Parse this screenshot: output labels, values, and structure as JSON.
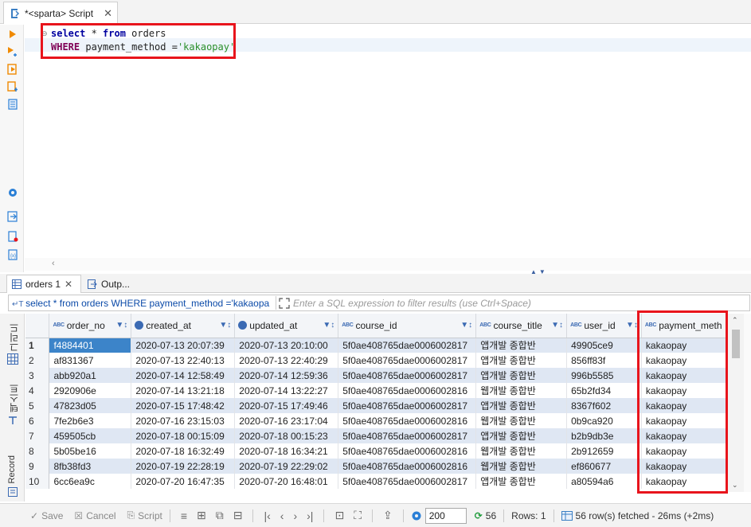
{
  "editor_tab": {
    "title": "*<sparta> Script",
    "close": "✕"
  },
  "editor": {
    "line1": {
      "k1": "select",
      "t1": " * ",
      "k2": "from",
      "t2": " orders"
    },
    "line2": {
      "k1": "WHERE",
      "t1": " payment_method =",
      "s1": "'kakaopay'"
    }
  },
  "result_tabs": [
    {
      "label": "orders 1",
      "close": "✕"
    },
    {
      "label": "Outp..."
    }
  ],
  "filter": {
    "query": "select * from orders WHERE payment_method ='kakaopa",
    "placeholder": "Enter a SQL expression to filter results (use Ctrl+Space)"
  },
  "side_tabs": [
    "그리드",
    "텍스트",
    "Record"
  ],
  "columns": [
    {
      "name": "order_no",
      "type_badge": "ABC"
    },
    {
      "name": "created_at",
      "type_badge": "clock"
    },
    {
      "name": "updated_at",
      "type_badge": "clock"
    },
    {
      "name": "course_id",
      "type_badge": "ABC"
    },
    {
      "name": "course_title",
      "type_badge": "ABC"
    },
    {
      "name": "user_id",
      "type_badge": "ABC"
    },
    {
      "name": "payment_meth",
      "type_badge": "ABC"
    }
  ],
  "rows": [
    [
      "1",
      "f4884401",
      "2020-07-13 20:07:39",
      "2020-07-13 20:10:00",
      "5f0ae408765dae0006002817",
      "앱개발 종합반",
      "49905ce9",
      "kakaopay"
    ],
    [
      "2",
      "af831367",
      "2020-07-13 22:40:13",
      "2020-07-13 22:40:29",
      "5f0ae408765dae0006002817",
      "앱개발 종합반",
      "856ff83f",
      "kakaopay"
    ],
    [
      "3",
      "abb920a1",
      "2020-07-14 12:58:49",
      "2020-07-14 12:59:36",
      "5f0ae408765dae0006002817",
      "앱개발 종합반",
      "996b5585",
      "kakaopay"
    ],
    [
      "4",
      "2920906e",
      "2020-07-14 13:21:18",
      "2020-07-14 13:22:27",
      "5f0ae408765dae0006002816",
      "웹개발 종합반",
      "65b2fd34",
      "kakaopay"
    ],
    [
      "5",
      "47823d05",
      "2020-07-15 17:48:42",
      "2020-07-15 17:49:46",
      "5f0ae408765dae0006002817",
      "앱개발 종합반",
      "8367f602",
      "kakaopay"
    ],
    [
      "6",
      "7fe2b6e3",
      "2020-07-16 23:15:03",
      "2020-07-16 23:17:04",
      "5f0ae408765dae0006002816",
      "웹개발 종합반",
      "0b9ca920",
      "kakaopay"
    ],
    [
      "7",
      "459505cb",
      "2020-07-18 00:15:09",
      "2020-07-18 00:15:23",
      "5f0ae408765dae0006002817",
      "앱개발 종합반",
      "b2b9db3e",
      "kakaopay"
    ],
    [
      "8",
      "5b05be16",
      "2020-07-18 16:32:49",
      "2020-07-18 16:34:21",
      "5f0ae408765dae0006002816",
      "웹개발 종합반",
      "2b912659",
      "kakaopay"
    ],
    [
      "9",
      "8fb38fd3",
      "2020-07-19 22:28:19",
      "2020-07-19 22:29:02",
      "5f0ae408765dae0006002816",
      "웹개발 종합반",
      "ef860677",
      "kakaopay"
    ],
    [
      "10",
      "6cc6ea9c",
      "2020-07-20 16:47:35",
      "2020-07-20 16:48:01",
      "5f0ae408765dae0006002817",
      "앱개발 종합반",
      "a80594a6",
      "kakaopay"
    ]
  ],
  "bottom": {
    "save": "Save",
    "cancel": "Cancel",
    "script": "Script",
    "limit": "200",
    "refresh_count": "56",
    "rows_info": "Rows: 1",
    "fetch_info": "56 row(s) fetched - 26ms (+2ms)"
  },
  "colors": {
    "highlight_box": "#e8141c",
    "selected_cell": "#3c84c9",
    "stripe": "#dfe7f3"
  }
}
